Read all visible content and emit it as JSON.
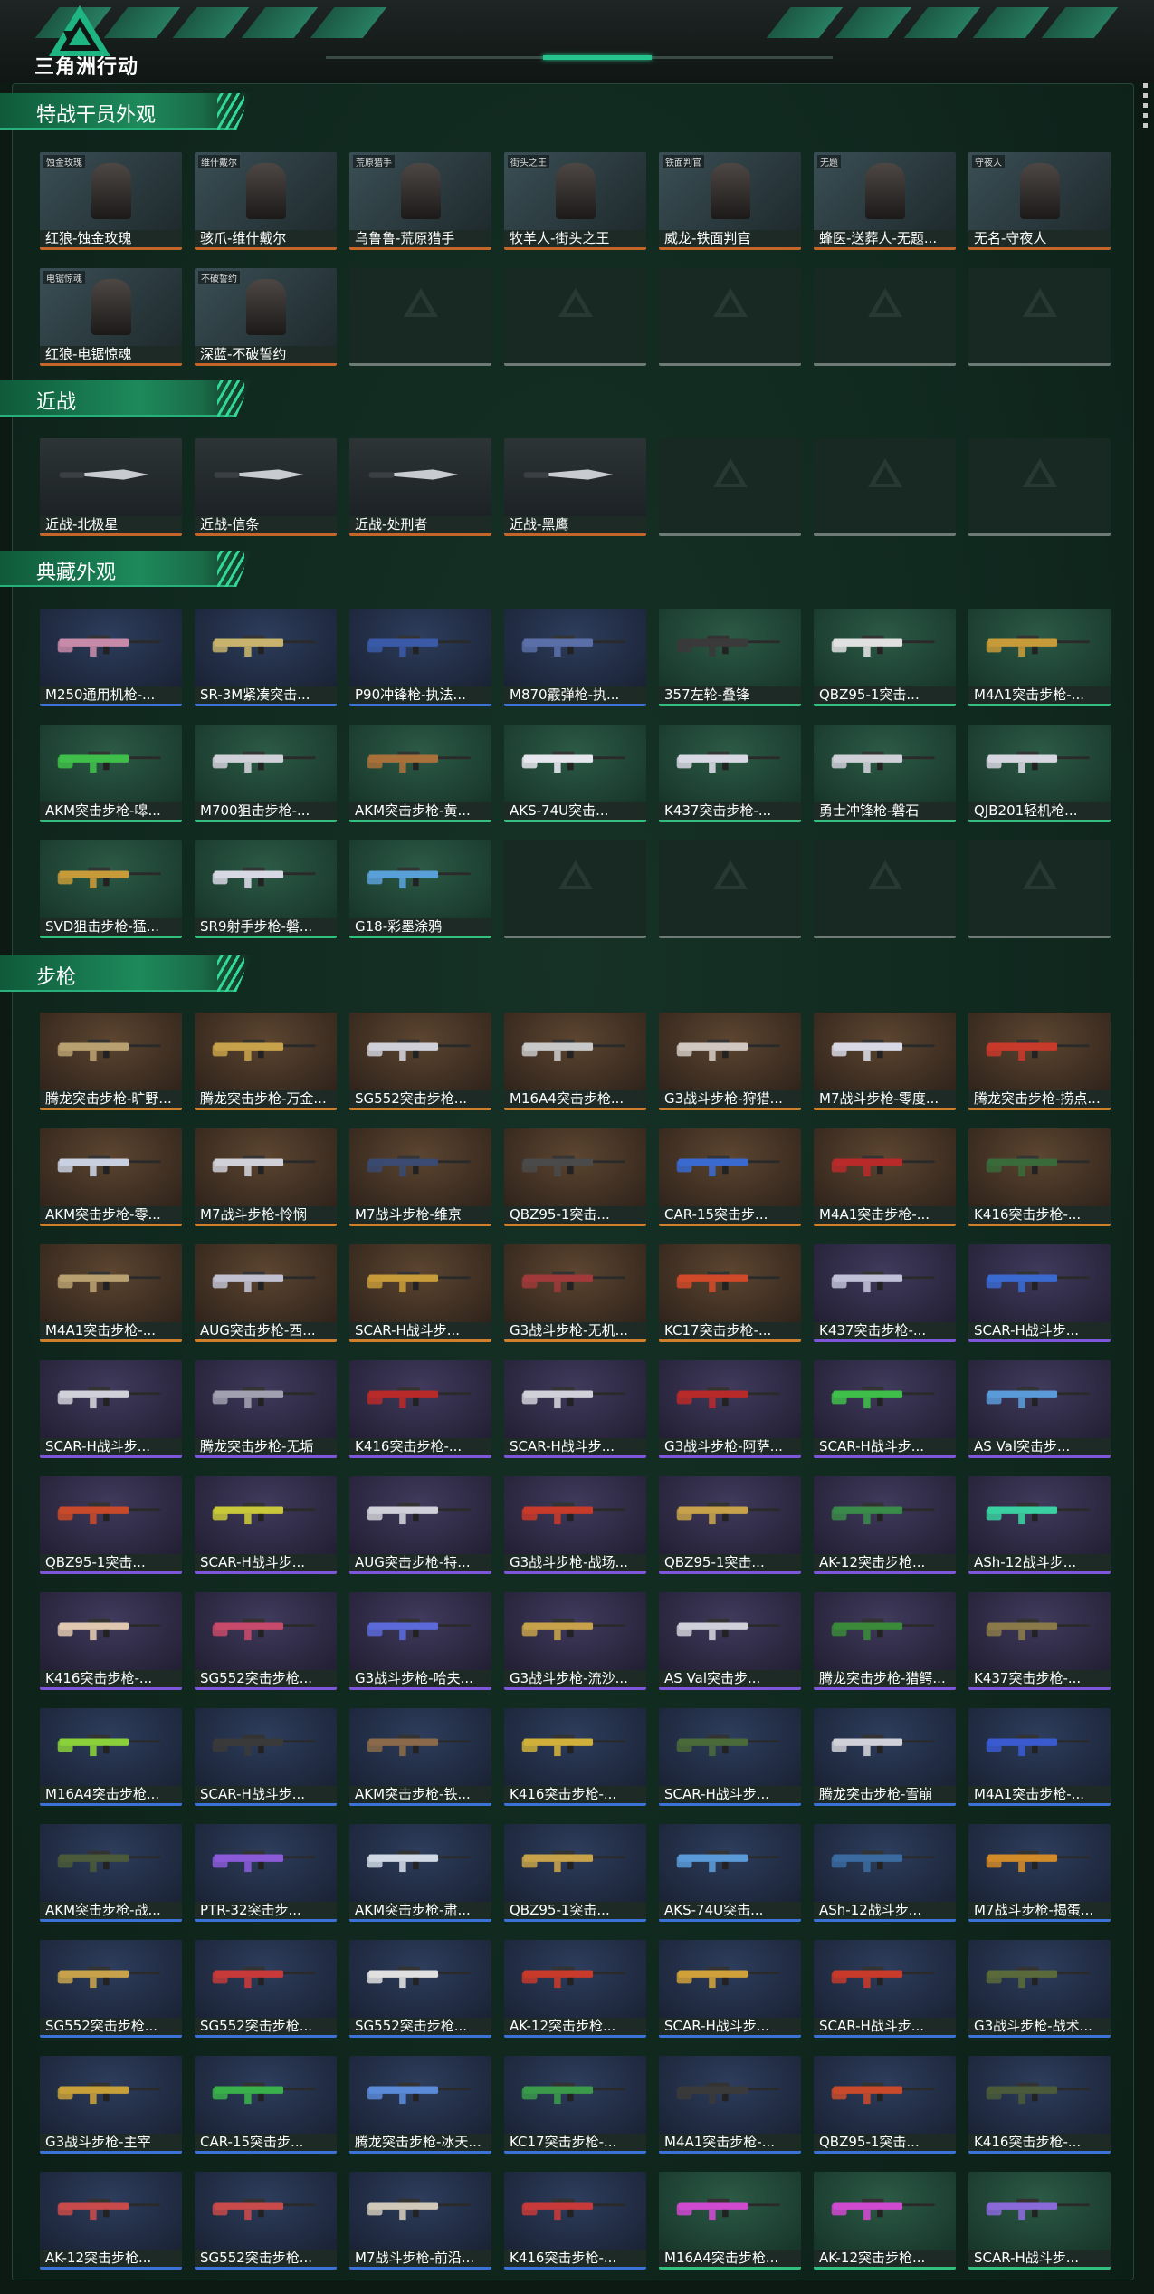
{
  "header": {
    "logo_text": "三角洲行动",
    "logo_icon": "delta-triangle-logo"
  },
  "colors": {
    "accent": "#26c38e",
    "red": "#c4662a",
    "purple": "#7f56d9",
    "blue": "#3a72d6",
    "green": "#33c07f"
  },
  "sections": [
    {
      "title": "特战干员外观",
      "items": [
        {
          "name": "红狼-蚀金玫瑰",
          "rarity": "red",
          "tag": "蚀金玫瑰"
        },
        {
          "name": "骇爪-维什戴尔",
          "rarity": "red",
          "tag": "维什戴尔"
        },
        {
          "name": "乌鲁鲁-荒原猎手",
          "rarity": "red",
          "tag": "荒原猎手"
        },
        {
          "name": "牧羊人-街头之王",
          "rarity": "red",
          "tag": "街头之王"
        },
        {
          "name": "威龙-铁面判官",
          "rarity": "red",
          "tag": "铁面判官"
        },
        {
          "name": "蜂医-送葬人-无题...",
          "rarity": "red",
          "tag": "无题"
        },
        {
          "name": "无名-守夜人",
          "rarity": "red",
          "tag": "守夜人"
        },
        {
          "name": "红狼-电锯惊魂",
          "rarity": "red",
          "tag": "电锯惊魂"
        },
        {
          "name": "深蓝-不破誓约",
          "rarity": "red",
          "tag": "不破誓约"
        },
        {
          "name": "",
          "rarity": "empty"
        },
        {
          "name": "",
          "rarity": "empty"
        },
        {
          "name": "",
          "rarity": "empty"
        },
        {
          "name": "",
          "rarity": "empty"
        },
        {
          "name": "",
          "rarity": "empty"
        }
      ]
    },
    {
      "title": "近战",
      "items": [
        {
          "name": "近战-北极星",
          "rarity": "red",
          "kind": "knife"
        },
        {
          "name": "近战-信条",
          "rarity": "red",
          "kind": "knife"
        },
        {
          "name": "近战-处刑者",
          "rarity": "red",
          "kind": "knife"
        },
        {
          "name": "近战-黑鹰",
          "rarity": "red",
          "kind": "knife"
        },
        {
          "name": "",
          "rarity": "empty"
        },
        {
          "name": "",
          "rarity": "empty"
        },
        {
          "name": "",
          "rarity": "empty"
        }
      ]
    },
    {
      "title": "典藏外观",
      "items": [
        {
          "name": "M250通用机枪-...",
          "rarity": "blue",
          "gun": "#c78aa8"
        },
        {
          "name": "SR-3M紧凑突击...",
          "rarity": "blue",
          "gun": "#c7b36d"
        },
        {
          "name": "P90冲锋枪-执法...",
          "rarity": "blue",
          "gun": "#3a5aa8"
        },
        {
          "name": "M870霰弹枪-执...",
          "rarity": "blue",
          "gun": "#5a6fa8"
        },
        {
          "name": "357左轮-叠锋",
          "rarity": "green",
          "gun": "#3a3a3a"
        },
        {
          "name": "QBZ95-1突击...",
          "rarity": "green",
          "gun": "#e0e0e0"
        },
        {
          "name": "M4A1突击步枪-...",
          "rarity": "green",
          "gun": "#c79a3a"
        },
        {
          "name": "AKM突击步枪-嗥...",
          "rarity": "green",
          "gun": "#3fbf4a"
        },
        {
          "name": "M700狙击步枪-...",
          "rarity": "green",
          "gun": "#d0d0d8"
        },
        {
          "name": "AKM突击步枪-黄...",
          "rarity": "green",
          "gun": "#a8703a"
        },
        {
          "name": "AKS-74U突击...",
          "rarity": "green",
          "gun": "#e6e6ee"
        },
        {
          "name": "K437突击步枪-...",
          "rarity": "green",
          "gun": "#d8d8e4"
        },
        {
          "name": "勇士冲锋枪-磐石",
          "rarity": "green",
          "gun": "#cfcfd8"
        },
        {
          "name": "QJB201轻机枪...",
          "rarity": "green",
          "gun": "#d6d6e0"
        },
        {
          "name": "SVD狙击步枪-猛...",
          "rarity": "green",
          "gun": "#c79a3a"
        },
        {
          "name": "SR9射手步枪-磐...",
          "rarity": "green",
          "gun": "#d8d8e4"
        },
        {
          "name": "G18-彩墨涂鸦",
          "rarity": "green",
          "gun": "#5aa0d8"
        },
        {
          "name": "",
          "rarity": "empty"
        },
        {
          "name": "",
          "rarity": "empty"
        },
        {
          "name": "",
          "rarity": "empty"
        },
        {
          "name": "",
          "rarity": "empty"
        }
      ]
    },
    {
      "title": "步枪",
      "items": [
        {
          "name": "腾龙突击步枪-旷野...",
          "rarity": "gold",
          "gun": "#b8a070"
        },
        {
          "name": "腾龙突击步枪-万金...",
          "rarity": "gold",
          "gun": "#c7a24a"
        },
        {
          "name": "SG552突击步枪...",
          "rarity": "gold",
          "gun": "#d0d0d8"
        },
        {
          "name": "M16A4突击步枪...",
          "rarity": "gold",
          "gun": "#c8c8c8"
        },
        {
          "name": "G3战斗步枪-狩猎...",
          "rarity": "gold",
          "gun": "#d0c8c0"
        },
        {
          "name": "M7战斗步枪-零度...",
          "rarity": "gold",
          "gun": "#d8d8e4"
        },
        {
          "name": "腾龙突击步枪-捞点...",
          "rarity": "gold",
          "gun": "#c83a2a"
        },
        {
          "name": "AKM突击步枪-零...",
          "rarity": "gold",
          "gun": "#c8d0e0"
        },
        {
          "name": "M7战斗步枪-怜悯",
          "rarity": "gold",
          "gun": "#d0d0d8"
        },
        {
          "name": "M7战斗步枪-维京",
          "rarity": "gold",
          "gun": "#3a4a70"
        },
        {
          "name": "QBZ95-1突击...",
          "rarity": "gold",
          "gun": "#4a4a4a"
        },
        {
          "name": "CAR-15突击步...",
          "rarity": "gold",
          "gun": "#3a6ad0"
        },
        {
          "name": "M4A1突击步枪-...",
          "rarity": "gold",
          "gun": "#b82a2a"
        },
        {
          "name": "K416突击步枪-...",
          "rarity": "gold",
          "gun": "#3a6a3a"
        },
        {
          "name": "M4A1突击步枪-...",
          "rarity": "gold",
          "gun": "#b8a070"
        },
        {
          "name": "AUG突击步枪-西...",
          "rarity": "gold",
          "gun": "#c0c0d0"
        },
        {
          "name": "SCAR-H战斗步...",
          "rarity": "gold",
          "gun": "#c79a3a"
        },
        {
          "name": "G3战斗步枪-无机...",
          "rarity": "gold",
          "gun": "#a03a3a"
        },
        {
          "name": "KC17突击步枪-...",
          "rarity": "gold",
          "gun": "#d04a2a"
        },
        {
          "name": "K437突击步枪-...",
          "rarity": "purple",
          "gun": "#c0c0d8"
        },
        {
          "name": "SCAR-H战斗步...",
          "rarity": "purple",
          "gun": "#3a6ad0"
        },
        {
          "name": "SCAR-H战斗步...",
          "rarity": "purple",
          "gun": "#d0d0d8"
        },
        {
          "name": "腾龙突击步枪-无垢",
          "rarity": "purple",
          "gun": "#a0a0b0"
        },
        {
          "name": "K416突击步枪-...",
          "rarity": "purple",
          "gun": "#b82a2a"
        },
        {
          "name": "SCAR-H战斗步...",
          "rarity": "purple",
          "gun": "#d0d0d8"
        },
        {
          "name": "G3战斗步枪-阿萨...",
          "rarity": "purple",
          "gun": "#b82a2a"
        },
        {
          "name": "SCAR-H战斗步...",
          "rarity": "purple",
          "gun": "#3fbf4a"
        },
        {
          "name": "AS Val突击步...",
          "rarity": "purple",
          "gun": "#5a9ad8"
        },
        {
          "name": "QBZ95-1突击...",
          "rarity": "purple",
          "gun": "#c84a2a"
        },
        {
          "name": "SCAR-H战斗步...",
          "rarity": "purple",
          "gun": "#c8c83a"
        },
        {
          "name": "AUG突击步枪-特...",
          "rarity": "purple",
          "gun": "#d0d0d8"
        },
        {
          "name": "G3战斗步枪-战场...",
          "rarity": "purple",
          "gun": "#c83a2a"
        },
        {
          "name": "QBZ95-1突击...",
          "rarity": "purple",
          "gun": "#c7a24a"
        },
        {
          "name": "AK-12突击步枪...",
          "rarity": "purple",
          "gun": "#3a8a4a"
        },
        {
          "name": "ASh-12战斗步...",
          "rarity": "purple",
          "gun": "#3ad0a0"
        },
        {
          "name": "K416突击步枪-...",
          "rarity": "purple",
          "gun": "#e0c8b0"
        },
        {
          "name": "SG552突击步枪...",
          "rarity": "purple",
          "gun": "#c84a6a"
        },
        {
          "name": "G3战斗步枪-哈夫...",
          "rarity": "purple",
          "gun": "#5a6ad8"
        },
        {
          "name": "G3战斗步枪-流沙...",
          "rarity": "purple",
          "gun": "#c7a24a"
        },
        {
          "name": "AS Val突击步...",
          "rarity": "purple",
          "gun": "#d0d0d8"
        },
        {
          "name": "腾龙突击步枪-猎鳄...",
          "rarity": "purple",
          "gun": "#3a8a3a"
        },
        {
          "name": "K437突击步枪-...",
          "rarity": "purple",
          "gun": "#8a7a4a"
        },
        {
          "name": "M16A4突击步枪...",
          "rarity": "blue",
          "gun": "#8ad03a"
        },
        {
          "name": "SCAR-H战斗步...",
          "rarity": "blue",
          "gun": "#3a3a3a"
        },
        {
          "name": "AKM突击步枪-铁...",
          "rarity": "blue",
          "gun": "#8a6a4a"
        },
        {
          "name": "K416突击步枪-...",
          "rarity": "blue",
          "gun": "#d0b03a"
        },
        {
          "name": "SCAR-H战斗步...",
          "rarity": "blue",
          "gun": "#4a6a3a"
        },
        {
          "name": "腾龙突击步枪-雪崩",
          "rarity": "blue",
          "gun": "#d0d0d8"
        },
        {
          "name": "M4A1突击步枪-...",
          "rarity": "blue",
          "gun": "#3a5ad0"
        },
        {
          "name": "AKM突击步枪-战...",
          "rarity": "blue",
          "gun": "#4a5a3a"
        },
        {
          "name": "PTR-32突击步...",
          "rarity": "blue",
          "gun": "#8a5ad8"
        },
        {
          "name": "AKM突击步枪-肃...",
          "rarity": "blue",
          "gun": "#d0d8e4"
        },
        {
          "name": "QBZ95-1突击...",
          "rarity": "blue",
          "gun": "#c7a24a"
        },
        {
          "name": "AKS-74U突击...",
          "rarity": "blue",
          "gun": "#5a9ad8"
        },
        {
          "name": "ASh-12战斗步...",
          "rarity": "blue",
          "gun": "#3a6aa0"
        },
        {
          "name": "M7战斗步枪-揭蛋...",
          "rarity": "blue",
          "gun": "#d08a2a"
        },
        {
          "name": "SG552突击步枪...",
          "rarity": "blue",
          "gun": "#c7a24a"
        },
        {
          "name": "SG552突击步枪...",
          "rarity": "blue",
          "gun": "#c83a3a"
        },
        {
          "name": "SG552突击步枪...",
          "rarity": "blue",
          "gun": "#e0e0e0"
        },
        {
          "name": "AK-12突击步枪...",
          "rarity": "blue",
          "gun": "#c83a2a"
        },
        {
          "name": "SCAR-H战斗步...",
          "rarity": "blue",
          "gun": "#d0a03a"
        },
        {
          "name": "SCAR-H战斗步...",
          "rarity": "blue",
          "gun": "#c83a2a"
        },
        {
          "name": "G3战斗步枪-战术...",
          "rarity": "blue",
          "gun": "#5a6a3a"
        },
        {
          "name": "G3战斗步枪-主宰",
          "rarity": "blue",
          "gun": "#c8a03a"
        },
        {
          "name": "CAR-15突击步...",
          "rarity": "blue",
          "gun": "#3ab04a"
        },
        {
          "name": "腾龙突击步枪-冰天...",
          "rarity": "blue",
          "gun": "#5a8ad8"
        },
        {
          "name": "KC17突击步枪-...",
          "rarity": "blue",
          "gun": "#3a9a4a"
        },
        {
          "name": "M4A1突击步枪-...",
          "rarity": "blue",
          "gun": "#3a3a3a"
        },
        {
          "name": "QBZ95-1突击...",
          "rarity": "blue",
          "gun": "#c84a2a"
        },
        {
          "name": "K416突击步枪-...",
          "rarity": "blue",
          "gun": "#4a5a3a"
        },
        {
          "name": "AK-12突击步枪...",
          "rarity": "blue",
          "gun": "#c84a4a"
        },
        {
          "name": "SG552突击步枪...",
          "rarity": "blue",
          "gun": "#c84a4a"
        },
        {
          "name": "M7战斗步枪-前沿...",
          "rarity": "blue",
          "gun": "#d0c8b8"
        },
        {
          "name": "K416突击步枪-...",
          "rarity": "blue",
          "gun": "#c83a3a"
        },
        {
          "name": "M16A4突击步枪...",
          "rarity": "green",
          "gun": "#d04ad0"
        },
        {
          "name": "AK-12突击步枪...",
          "rarity": "green",
          "gun": "#d04ad0"
        },
        {
          "name": "SCAR-H战斗步...",
          "rarity": "green",
          "gun": "#8a6ad8"
        }
      ]
    }
  ]
}
